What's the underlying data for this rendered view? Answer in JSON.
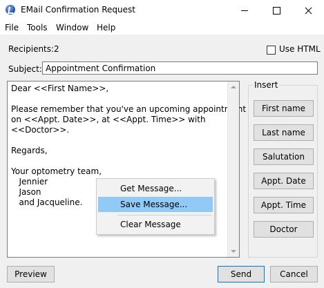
{
  "window": {
    "title": "EMail Confirmation Request",
    "icon": "app-logo-icon"
  },
  "menu": {
    "items": [
      "File",
      "Tools",
      "Window",
      "Help"
    ]
  },
  "recipients": {
    "label": "Recipients:",
    "count": "2"
  },
  "html_option": {
    "label": "Use HTML",
    "checked": false
  },
  "subject": {
    "label": "Subject:",
    "value": "Appointment Confirmation"
  },
  "body": {
    "text": "Dear <<First Name>>,\n\nPlease remember that you've an upcoming appointment\non <<Appt. Date>>, at <<Appt. Time>> with\n<<Doctor>>.\n\nRegards,\n\nYour optometry team,\n   Jennier\n   Jason\n   and Jacqueline."
  },
  "context_menu": {
    "get": "Get Message...",
    "save": "Save Message...",
    "clear": "Clear Message",
    "highlighted": "save"
  },
  "insert": {
    "legend": "Insert",
    "buttons": [
      "First name",
      "Last name",
      "Salutation",
      "Appt. Date",
      "Appt. Time",
      "Doctor"
    ]
  },
  "footer": {
    "preview": "Preview",
    "send": "Send",
    "cancel": "Cancel"
  },
  "colors": {
    "highlight": "#91c9f7",
    "default_button_border": "#0078d7"
  }
}
